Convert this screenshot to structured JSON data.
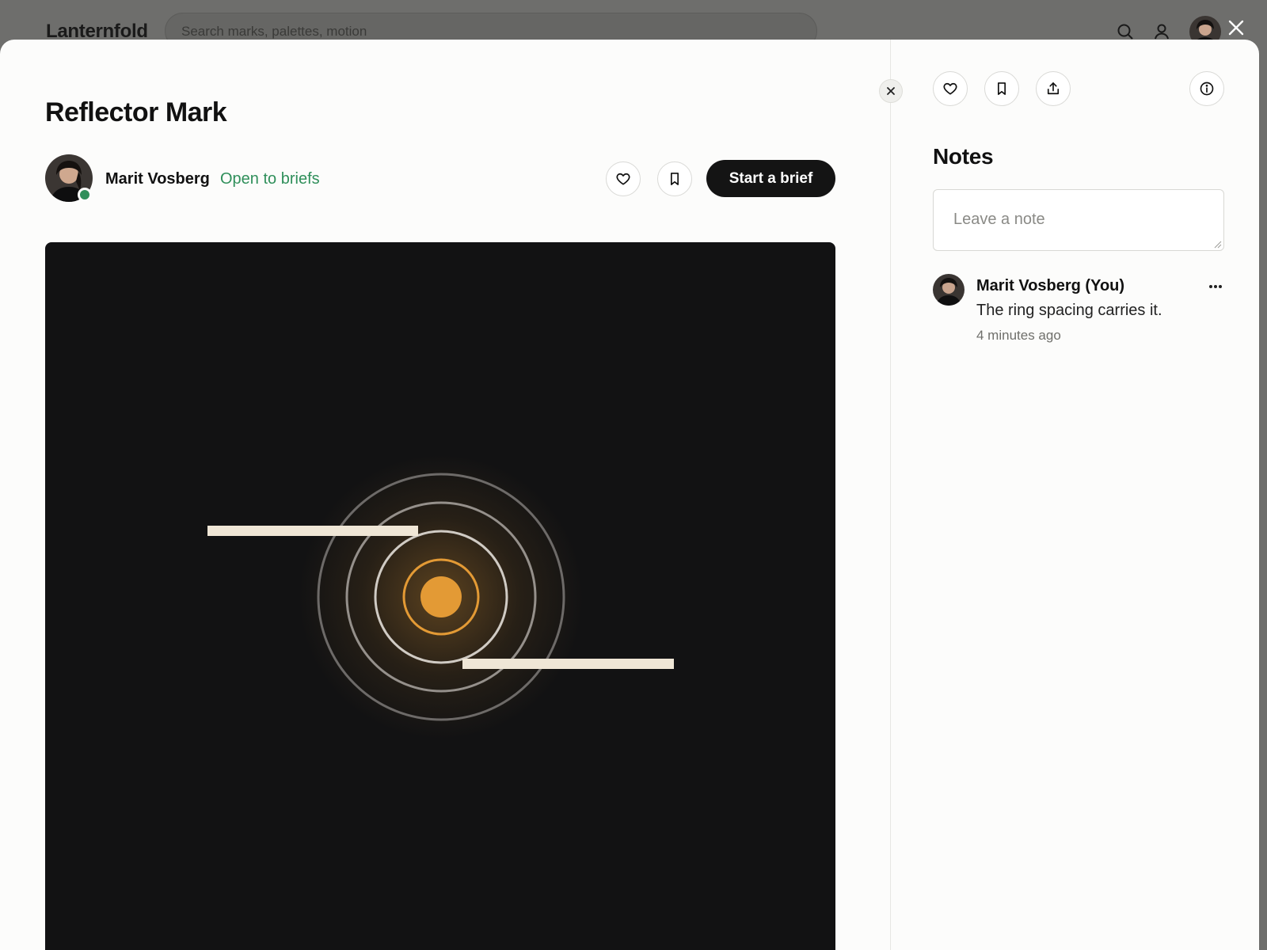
{
  "site": {
    "logo": "Lanternfold",
    "search_placeholder": "Search marks, palettes, motion"
  },
  "shot": {
    "title": "Reflector Mark",
    "author_name": "Marit Vosberg",
    "author_status": "Open to briefs",
    "start_brief_label": "Start a brief"
  },
  "notes": {
    "title": "Notes",
    "input_placeholder": "Leave a note",
    "items": [
      {
        "author": "Marit Vosberg (You)",
        "text": "The ring spacing carries it.",
        "time": "4 minutes ago"
      }
    ]
  },
  "colors": {
    "accent_green": "#2f8f5a",
    "artwork_bg": "#121213",
    "artwork_orange": "#e39a35",
    "artwork_cream": "#efe6d6",
    "button_dark": "#141414"
  },
  "icons": {
    "search": "search-icon",
    "user": "user-icon",
    "close": "close-icon",
    "heart": "heart-icon",
    "bookmark": "bookmark-icon",
    "share": "share-icon",
    "info": "info-icon",
    "more": "more-icon"
  }
}
